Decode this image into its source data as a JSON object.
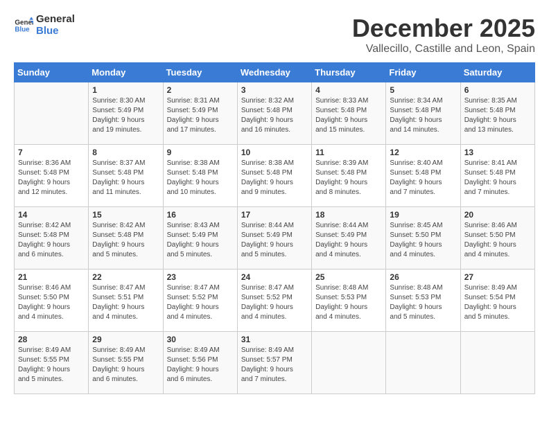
{
  "header": {
    "logo_line1": "General",
    "logo_line2": "Blue",
    "title": "December 2025",
    "subtitle": "Vallecillo, Castille and Leon, Spain"
  },
  "calendar": {
    "days_of_week": [
      "Sunday",
      "Monday",
      "Tuesday",
      "Wednesday",
      "Thursday",
      "Friday",
      "Saturday"
    ],
    "weeks": [
      [
        {
          "day": "",
          "info": ""
        },
        {
          "day": "1",
          "info": "Sunrise: 8:30 AM\nSunset: 5:49 PM\nDaylight: 9 hours\nand 19 minutes."
        },
        {
          "day": "2",
          "info": "Sunrise: 8:31 AM\nSunset: 5:49 PM\nDaylight: 9 hours\nand 17 minutes."
        },
        {
          "day": "3",
          "info": "Sunrise: 8:32 AM\nSunset: 5:48 PM\nDaylight: 9 hours\nand 16 minutes."
        },
        {
          "day": "4",
          "info": "Sunrise: 8:33 AM\nSunset: 5:48 PM\nDaylight: 9 hours\nand 15 minutes."
        },
        {
          "day": "5",
          "info": "Sunrise: 8:34 AM\nSunset: 5:48 PM\nDaylight: 9 hours\nand 14 minutes."
        },
        {
          "day": "6",
          "info": "Sunrise: 8:35 AM\nSunset: 5:48 PM\nDaylight: 9 hours\nand 13 minutes."
        }
      ],
      [
        {
          "day": "7",
          "info": "Sunrise: 8:36 AM\nSunset: 5:48 PM\nDaylight: 9 hours\nand 12 minutes."
        },
        {
          "day": "8",
          "info": "Sunrise: 8:37 AM\nSunset: 5:48 PM\nDaylight: 9 hours\nand 11 minutes."
        },
        {
          "day": "9",
          "info": "Sunrise: 8:38 AM\nSunset: 5:48 PM\nDaylight: 9 hours\nand 10 minutes."
        },
        {
          "day": "10",
          "info": "Sunrise: 8:38 AM\nSunset: 5:48 PM\nDaylight: 9 hours\nand 9 minutes."
        },
        {
          "day": "11",
          "info": "Sunrise: 8:39 AM\nSunset: 5:48 PM\nDaylight: 9 hours\nand 8 minutes."
        },
        {
          "day": "12",
          "info": "Sunrise: 8:40 AM\nSunset: 5:48 PM\nDaylight: 9 hours\nand 7 minutes."
        },
        {
          "day": "13",
          "info": "Sunrise: 8:41 AM\nSunset: 5:48 PM\nDaylight: 9 hours\nand 7 minutes."
        }
      ],
      [
        {
          "day": "14",
          "info": "Sunrise: 8:42 AM\nSunset: 5:48 PM\nDaylight: 9 hours\nand 6 minutes."
        },
        {
          "day": "15",
          "info": "Sunrise: 8:42 AM\nSunset: 5:48 PM\nDaylight: 9 hours\nand 5 minutes."
        },
        {
          "day": "16",
          "info": "Sunrise: 8:43 AM\nSunset: 5:49 PM\nDaylight: 9 hours\nand 5 minutes."
        },
        {
          "day": "17",
          "info": "Sunrise: 8:44 AM\nSunset: 5:49 PM\nDaylight: 9 hours\nand 5 minutes."
        },
        {
          "day": "18",
          "info": "Sunrise: 8:44 AM\nSunset: 5:49 PM\nDaylight: 9 hours\nand 4 minutes."
        },
        {
          "day": "19",
          "info": "Sunrise: 8:45 AM\nSunset: 5:50 PM\nDaylight: 9 hours\nand 4 minutes."
        },
        {
          "day": "20",
          "info": "Sunrise: 8:46 AM\nSunset: 5:50 PM\nDaylight: 9 hours\nand 4 minutes."
        }
      ],
      [
        {
          "day": "21",
          "info": "Sunrise: 8:46 AM\nSunset: 5:50 PM\nDaylight: 9 hours\nand 4 minutes."
        },
        {
          "day": "22",
          "info": "Sunrise: 8:47 AM\nSunset: 5:51 PM\nDaylight: 9 hours\nand 4 minutes."
        },
        {
          "day": "23",
          "info": "Sunrise: 8:47 AM\nSunset: 5:52 PM\nDaylight: 9 hours\nand 4 minutes."
        },
        {
          "day": "24",
          "info": "Sunrise: 8:47 AM\nSunset: 5:52 PM\nDaylight: 9 hours\nand 4 minutes."
        },
        {
          "day": "25",
          "info": "Sunrise: 8:48 AM\nSunset: 5:53 PM\nDaylight: 9 hours\nand 4 minutes."
        },
        {
          "day": "26",
          "info": "Sunrise: 8:48 AM\nSunset: 5:53 PM\nDaylight: 9 hours\nand 5 minutes."
        },
        {
          "day": "27",
          "info": "Sunrise: 8:49 AM\nSunset: 5:54 PM\nDaylight: 9 hours\nand 5 minutes."
        }
      ],
      [
        {
          "day": "28",
          "info": "Sunrise: 8:49 AM\nSunset: 5:55 PM\nDaylight: 9 hours\nand 5 minutes."
        },
        {
          "day": "29",
          "info": "Sunrise: 8:49 AM\nSunset: 5:55 PM\nDaylight: 9 hours\nand 6 minutes."
        },
        {
          "day": "30",
          "info": "Sunrise: 8:49 AM\nSunset: 5:56 PM\nDaylight: 9 hours\nand 6 minutes."
        },
        {
          "day": "31",
          "info": "Sunrise: 8:49 AM\nSunset: 5:57 PM\nDaylight: 9 hours\nand 7 minutes."
        },
        {
          "day": "",
          "info": ""
        },
        {
          "day": "",
          "info": ""
        },
        {
          "day": "",
          "info": ""
        }
      ]
    ]
  }
}
